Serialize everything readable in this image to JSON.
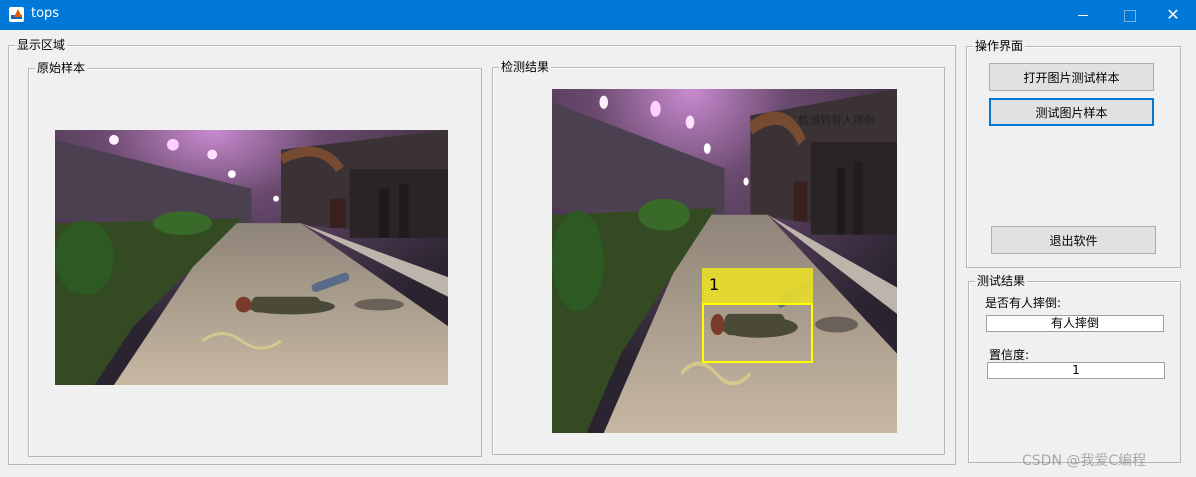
{
  "window": {
    "title": "tops",
    "controls": {
      "minimize": "",
      "maximize": "",
      "close": "✕"
    }
  },
  "display_area": {
    "label": "显示区域",
    "original_panel": {
      "label": "原始样本"
    },
    "result_panel": {
      "label": "检测结果",
      "overlay_text": "检测到有人摔倒",
      "detection": {
        "id": "1",
        "box_color": "#ffff00",
        "label_bg": "#e8dc2a"
      }
    }
  },
  "operation_panel": {
    "label": "操作界面",
    "open_button": "打开图片测试样本",
    "test_button": "测试图片样本",
    "exit_button": "退出软件"
  },
  "result_group": {
    "label": "测试结果",
    "fall_question": "是否有人摔倒:",
    "fall_value": "有人摔倒",
    "confidence_label": "置信度:",
    "confidence_value": "1"
  },
  "watermark": "CSDN @我爱C编程",
  "colors": {
    "titlebar": "#0078d7",
    "window_bg": "#f0f0f0",
    "focus": "#0078d7"
  }
}
